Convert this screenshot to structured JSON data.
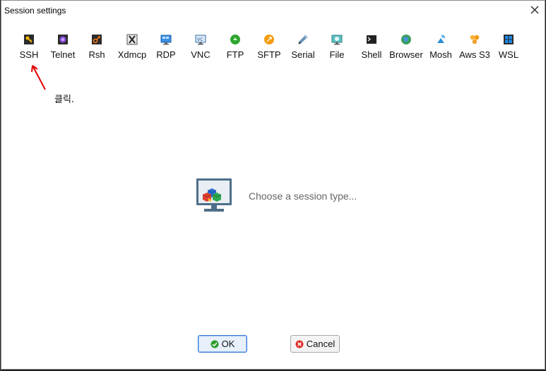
{
  "window": {
    "title": "Session settings"
  },
  "toolbar": {
    "items": [
      {
        "label": "SSH",
        "icon": "ssh-key-icon",
        "color": "#e0a000"
      },
      {
        "label": "Telnet",
        "icon": "telnet-icon",
        "color": "#7a3fd0"
      },
      {
        "label": "Rsh",
        "icon": "rsh-icon",
        "color": "#d04a00"
      },
      {
        "label": "Xdmcp",
        "icon": "xdmcp-icon",
        "color": "#333333"
      },
      {
        "label": "RDP",
        "icon": "rdp-icon",
        "color": "#1e88e5"
      },
      {
        "label": "VNC",
        "icon": "vnc-icon",
        "color": "#1e88e5"
      },
      {
        "label": "FTP",
        "icon": "ftp-icon",
        "color": "#2e9e2e"
      },
      {
        "label": "SFTP",
        "icon": "sftp-icon",
        "color": "#f39c12"
      },
      {
        "label": "Serial",
        "icon": "serial-icon",
        "color": "#6b8fb5"
      },
      {
        "label": "File",
        "icon": "file-icon",
        "color": "#2aa6a6"
      },
      {
        "label": "Shell",
        "icon": "shell-icon",
        "color": "#222222"
      },
      {
        "label": "Browser",
        "icon": "browser-icon",
        "color": "#2e9e5e"
      },
      {
        "label": "Mosh",
        "icon": "mosh-icon",
        "color": "#2a8fd8"
      },
      {
        "label": "Aws S3",
        "icon": "aws-s3-icon",
        "color": "#f0a030"
      },
      {
        "label": "WSL",
        "icon": "wsl-icon",
        "color": "#1e6fd8"
      }
    ]
  },
  "annotation": {
    "text": "클릭.",
    "arrow_color": "#e00000"
  },
  "main": {
    "prompt": "Choose a session type..."
  },
  "buttons": {
    "ok_label": "OK",
    "cancel_label": "Cancel"
  }
}
